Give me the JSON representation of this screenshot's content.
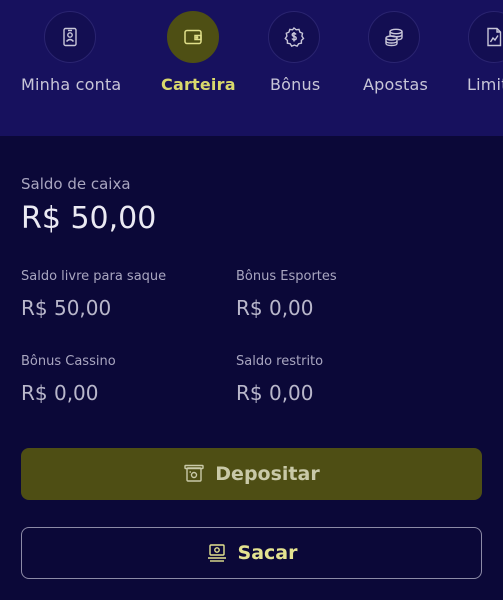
{
  "nav": {
    "items": [
      {
        "label": "Minha conta",
        "icon": "id-card-icon"
      },
      {
        "label": "Carteira",
        "icon": "wallet-icon",
        "active": true
      },
      {
        "label": "Bônus",
        "icon": "dollar-badge-icon"
      },
      {
        "label": "Apostas",
        "icon": "coins-stack-icon"
      },
      {
        "label": "Limit",
        "icon": "document-chart-icon"
      }
    ]
  },
  "wallet": {
    "cash_balance_label": "Saldo de caixa",
    "cash_balance_value": "R$ 50,00",
    "withdrawable_label": "Saldo livre para saque",
    "withdrawable_value": "R$ 50,00",
    "sports_bonus_label": "Bônus Esportes",
    "sports_bonus_value": "R$ 0,00",
    "casino_bonus_label": "Bônus Cassino",
    "casino_bonus_value": "R$ 0,00",
    "restricted_label": "Saldo restrito",
    "restricted_value": "R$ 0,00"
  },
  "actions": {
    "deposit_label": "Depositar",
    "withdraw_label": "Sacar"
  },
  "colors": {
    "background": "#0b0838",
    "nav_background": "#17115e",
    "accent": "#d9d86c",
    "deposit_button": "#4e4e14"
  }
}
